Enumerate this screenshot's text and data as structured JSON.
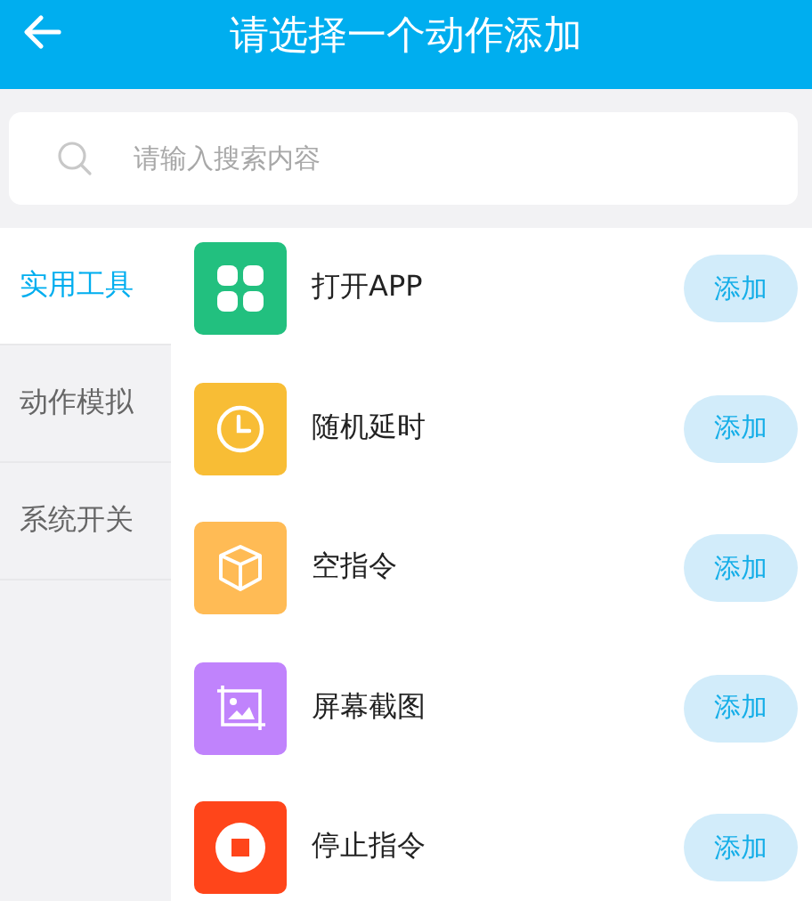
{
  "header": {
    "title": "请选择一个动作添加"
  },
  "search": {
    "placeholder": "请输入搜索内容"
  },
  "sidebar": {
    "items": [
      {
        "label": "实用工具",
        "selected": true
      },
      {
        "label": "动作模拟",
        "selected": false
      },
      {
        "label": "系统开关",
        "selected": false
      }
    ]
  },
  "actions": [
    {
      "name": "打开APP",
      "kind": "grid",
      "color": "#22c07f",
      "button": "添加"
    },
    {
      "name": "随机延时",
      "kind": "clock",
      "color": "#f8bd35",
      "button": "添加"
    },
    {
      "name": "空指令",
      "kind": "cube",
      "color": "#ffbb55",
      "button": "添加"
    },
    {
      "name": "屏幕截图",
      "kind": "crop",
      "color": "#c083fc",
      "button": "添加"
    },
    {
      "name": "停止指令",
      "kind": "stop",
      "color": "#ff451a",
      "button": "添加"
    }
  ]
}
